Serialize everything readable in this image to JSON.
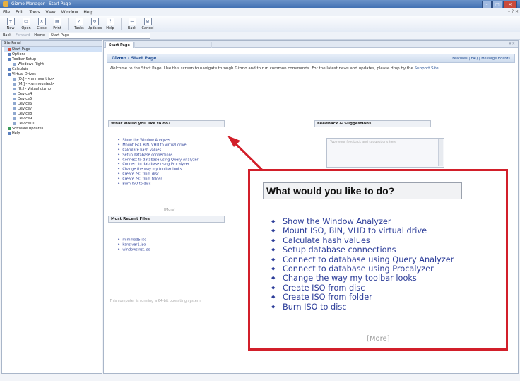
{
  "window": {
    "title": "Gizmo Manager - Start Page"
  },
  "menu": [
    "File",
    "Edit",
    "Tools",
    "View",
    "Window",
    "Help"
  ],
  "toolbar": [
    {
      "label": "New",
      "icon": "new-icon"
    },
    {
      "label": "Open",
      "icon": "open-icon"
    },
    {
      "label": "Close",
      "icon": "close-doc-icon"
    },
    {
      "label": "Print",
      "icon": "print-icon"
    },
    {
      "label": "Tasks",
      "icon": "tasks-icon"
    },
    {
      "label": "Updates",
      "icon": "updates-icon"
    },
    {
      "label": "Help",
      "icon": "help-icon"
    },
    {
      "label": "Back",
      "icon": "back-icon"
    },
    {
      "label": "Cancel",
      "icon": "cancel-icon"
    }
  ],
  "nav": {
    "back": "Back",
    "forward": "Forward",
    "home": "Home",
    "address": "Start Page"
  },
  "sidebar": {
    "header": "Site Panel",
    "items": [
      {
        "label": "Start Page",
        "level": 1,
        "selected": true,
        "color": "#d34a3a"
      },
      {
        "label": "Options",
        "level": 1,
        "color": "#5a7fbf"
      },
      {
        "label": "Toolbar Setup",
        "level": 1,
        "color": "#5a7fbf"
      },
      {
        "label": "Windows Right",
        "level": 2,
        "color": "#8fa8cf"
      },
      {
        "label": "Calculate",
        "level": 1,
        "color": "#5a7fbf"
      },
      {
        "label": "Virtual Drives",
        "level": 1,
        "color": "#5a7fbf"
      },
      {
        "label": "[D:] - <unmount to>",
        "level": 2,
        "color": "#8fa8cf"
      },
      {
        "label": "[M:] - <unmounted>",
        "level": 2,
        "color": "#8fa8cf"
      },
      {
        "label": "[R:] - Virtual gizmo",
        "level": 2,
        "color": "#8fa8cf"
      },
      {
        "label": "Device4",
        "level": 2,
        "color": "#8fa8cf"
      },
      {
        "label": "Device5",
        "level": 2,
        "color": "#8fa8cf"
      },
      {
        "label": "Device6",
        "level": 2,
        "color": "#8fa8cf"
      },
      {
        "label": "Device7",
        "level": 2,
        "color": "#8fa8cf"
      },
      {
        "label": "Device8",
        "level": 2,
        "color": "#8fa8cf"
      },
      {
        "label": "Device9",
        "level": 2,
        "color": "#8fa8cf"
      },
      {
        "label": "Device10",
        "level": 2,
        "color": "#8fa8cf"
      },
      {
        "label": "Software Updates",
        "level": 1,
        "color": "#3a9a5a"
      },
      {
        "label": "Help",
        "level": 1,
        "color": "#5a7fbf"
      }
    ]
  },
  "tabs": {
    "active": "Start Page",
    "inactive": ""
  },
  "banner": {
    "left": "Gizmo - Start Page",
    "right": "Features | FAQ | Message Boards"
  },
  "welcome": {
    "text": "Welcome to the Start Page. Use this screen to navigate through Gizmo and to run common commands. For the latest news and updates, please drop by the",
    "link": "Support Site."
  },
  "sections": {
    "todo": "What would you like to do?",
    "feedback": "Feedback & Suggestions",
    "recent": "Most Recent Files"
  },
  "tasks": [
    "Show the Window Analyzer",
    "Mount ISO, BIN, VHD to virtual drive",
    "Calculate hash values",
    "Setup database connections",
    "Connect to database using Query Analyzer",
    "Connect to database using Procalyzer",
    "Change the way my toolbar looks",
    "Create ISO from disc",
    "Create ISO from folder",
    "Burn ISO to disc"
  ],
  "more_label": "[More]",
  "recent_files": [
    "mimmod5.iso",
    "kansiver1.iso",
    "windowsinst.iso"
  ],
  "feedback_placeholder": "Type your feedback and suggestions here",
  "footer": "This computer is running a 64-bit operating system"
}
